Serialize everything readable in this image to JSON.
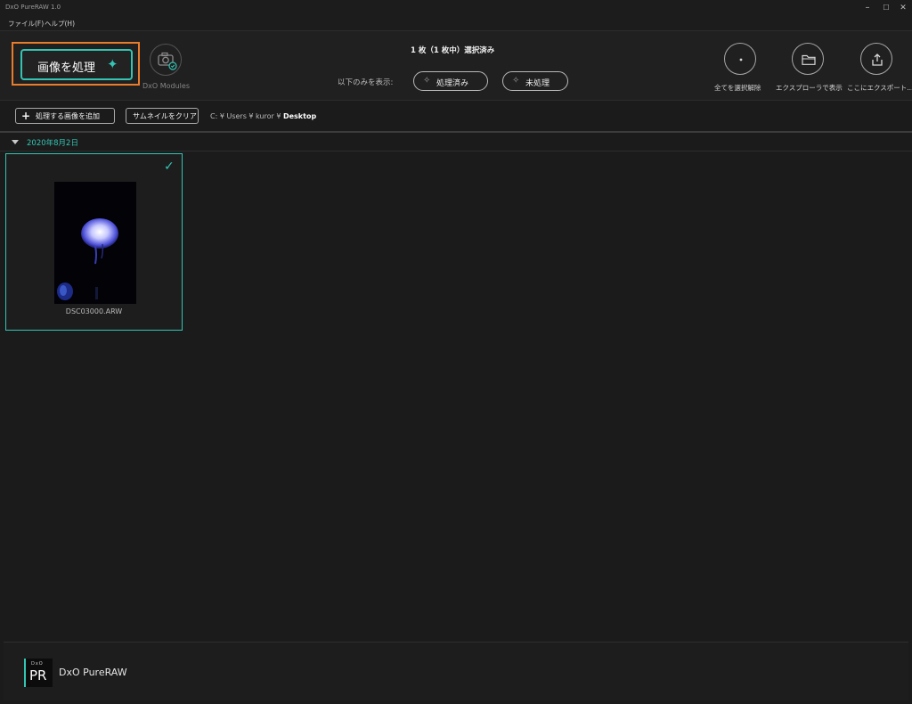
{
  "window": {
    "title": "DxO PureRAW 1.0",
    "controls": {
      "minimize": "–",
      "maximize": "☐",
      "close": "✕"
    }
  },
  "menu": {
    "file": "ファイル(F)",
    "help": "ヘルプ(H)"
  },
  "toolbar": {
    "process_label": "画像を処理",
    "process_icon": "sparkle-icon",
    "modules_label": "DxO Modules",
    "selection_status": "1 枚（1 枚中）選択済み",
    "show_only_label": "以下のみを表示:",
    "filter_processed": "処理済み",
    "filter_unprocessed": "未処理",
    "deselect_all": "全てを選択解除",
    "show_in_explorer": "エクスプローラで表示",
    "export_here": "ここにエクスポート..."
  },
  "subbar": {
    "add_images": "処理する画像を追加",
    "clear_thumbnails": "サムネイルをクリア",
    "path_prefix": "C: ¥ Users ¥ kuror ¥ ",
    "path_current": "Desktop"
  },
  "group": {
    "date": "2020年8月2日"
  },
  "images": [
    {
      "filename": "DSC03000.ARW",
      "selected": true
    }
  ],
  "footer": {
    "app_name": "DxO PureRAW",
    "logo_top": "DxO",
    "logo_main": "PR"
  },
  "colors": {
    "accent": "#33c4b4",
    "highlight_frame": "#e77d2c",
    "background": "#1b1b1b"
  }
}
